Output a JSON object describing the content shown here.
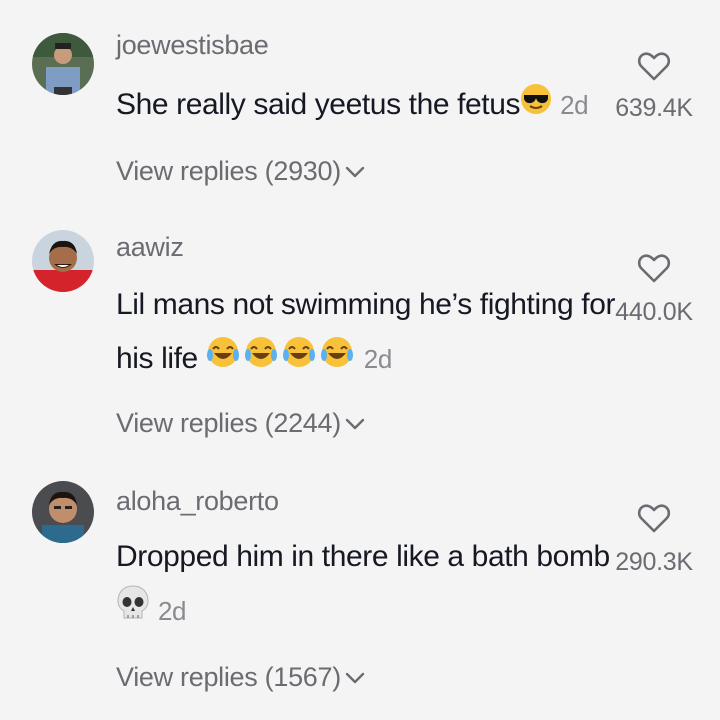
{
  "comments": [
    {
      "username": "joewestisbae",
      "text": "She really said yeetus the fetus",
      "emoji": "sunglasses-emoji",
      "time": "2d",
      "likes": "639.4K",
      "replies": "View replies (2930)"
    },
    {
      "username": "aawiz",
      "text_line1": "Lil mans not swimming he’s fighting for",
      "text_line2": "his life",
      "emoji": "tears-of-joy-emoji",
      "time": "2d",
      "likes": "440.0K",
      "replies": "View replies (2244)"
    },
    {
      "username": "aloha_roberto",
      "text": "Dropped him in there like a bath bomb",
      "emoji": "skull-emoji",
      "time": "2d",
      "likes": "290.3K",
      "replies": "View replies (1567)"
    }
  ]
}
